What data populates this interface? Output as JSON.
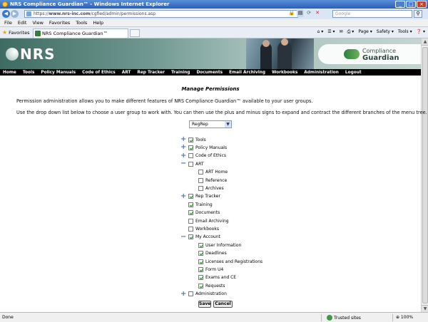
{
  "window": {
    "title": "NRS Compliance Guardian™ - Windows Internet Explorer"
  },
  "browser": {
    "url_protocol": "https://",
    "url_host": "www.nrs-inc.com",
    "url_path": "/cgfied/admin/permissions.asp",
    "search_placeholder": "Google",
    "menu": [
      "File",
      "Edit",
      "View",
      "Favorites",
      "Tools",
      "Help"
    ],
    "favorites_label": "Favorites",
    "tab_title": "NRS Compliance Guardian™",
    "commands": [
      "Page ▾",
      "Safety ▾",
      "Tools ▾",
      "❓ ▾"
    ]
  },
  "banner": {
    "logo_text": "NRS",
    "product_line1": "Compliance",
    "product_line2": "Guardian"
  },
  "site_nav": [
    "Home",
    "Tools",
    "Policy Manuals",
    "Code of Ethics",
    "ART",
    "Rep Tracker",
    "Training",
    "Documents",
    "Email Archiving",
    "Workbooks",
    "Administration",
    "Logout"
  ],
  "page": {
    "heading": "Manage Permissions",
    "intro_1": "Permission administration allows you to make different features of NRS Compliance Guardian™ available to your user groups.",
    "intro_2": "Use the drop down list below to choose a user group to work with.  You can then use the plus and minus signs to expand and contract the different branches of the menu tree.",
    "selected_group": "RegRep"
  },
  "tree": [
    {
      "label": "Tools",
      "checked": true,
      "toggle": "plus",
      "level": 0
    },
    {
      "label": "Policy Manuals",
      "checked": true,
      "toggle": "plus",
      "level": 0
    },
    {
      "label": "Code of Ethics",
      "checked": false,
      "toggle": "plus",
      "level": 0
    },
    {
      "label": "ART",
      "checked": false,
      "toggle": "minus",
      "level": 0
    },
    {
      "label": "ART Home",
      "checked": false,
      "toggle": "",
      "level": 1
    },
    {
      "label": "Reference",
      "checked": false,
      "toggle": "",
      "level": 1
    },
    {
      "label": "Archives",
      "checked": false,
      "toggle": "",
      "level": 1
    },
    {
      "label": "Rep Tracker",
      "checked": true,
      "toggle": "plus",
      "level": 0
    },
    {
      "label": "Training",
      "checked": true,
      "toggle": "",
      "level": 0
    },
    {
      "label": "Documents",
      "checked": true,
      "toggle": "",
      "level": 0
    },
    {
      "label": "Email Archiving",
      "checked": false,
      "toggle": "",
      "level": 0
    },
    {
      "label": "Workbooks",
      "checked": false,
      "toggle": "",
      "level": 0
    },
    {
      "label": "My Account",
      "checked": true,
      "toggle": "minus",
      "level": 0
    },
    {
      "label": "User Information",
      "checked": true,
      "toggle": "",
      "level": 1
    },
    {
      "label": "Deadlines",
      "checked": true,
      "toggle": "",
      "level": 1
    },
    {
      "label": "Licenses and Registrations",
      "checked": true,
      "toggle": "",
      "level": 1
    },
    {
      "label": "Form U4",
      "checked": true,
      "toggle": "",
      "level": 1
    },
    {
      "label": "Exams and CE",
      "checked": true,
      "toggle": "",
      "level": 1
    },
    {
      "label": "Requests",
      "checked": true,
      "toggle": "",
      "level": 1
    },
    {
      "label": "Administration",
      "checked": false,
      "toggle": "plus",
      "level": 0
    }
  ],
  "buttons": {
    "save": "Save",
    "cancel": "Cancel"
  },
  "status": {
    "left": "Done",
    "zone": "Trusted sites",
    "zoom": "⊕ 100%"
  },
  "colors": {
    "nav_bg": "#000000",
    "banner_green": "#3e6c62",
    "toggle_blue": "#4a79b8",
    "check_green": "#1f8a1f"
  }
}
